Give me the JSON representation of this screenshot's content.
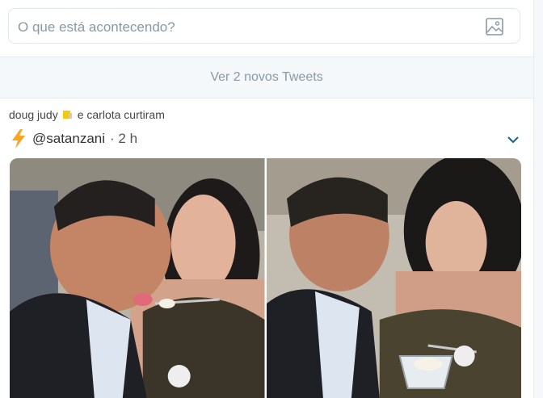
{
  "compose": {
    "placeholder": "O que está acontecendo?",
    "icon": "image-icon"
  },
  "new_tweets": {
    "label": "Ver 2 novos Tweets"
  },
  "tweet": {
    "social_context": {
      "user1": "doug judy",
      "user2_suffix": "e carlota curtiram"
    },
    "author_icon": "lightning-bolt-icon",
    "handle": "@satanzani",
    "time": "· 2 h",
    "photos": [
      {
        "alt_icon": "photo-man-eating-from-spoon"
      },
      {
        "alt_icon": "photo-woman-holding-cup"
      }
    ]
  },
  "colors": {
    "border": "#e6ecf0",
    "muted_text": "#8899a6",
    "new_tweets_bg": "#f5f8fa",
    "bolt_yellow": "#f5a623",
    "caret": "#1a5e8a"
  }
}
